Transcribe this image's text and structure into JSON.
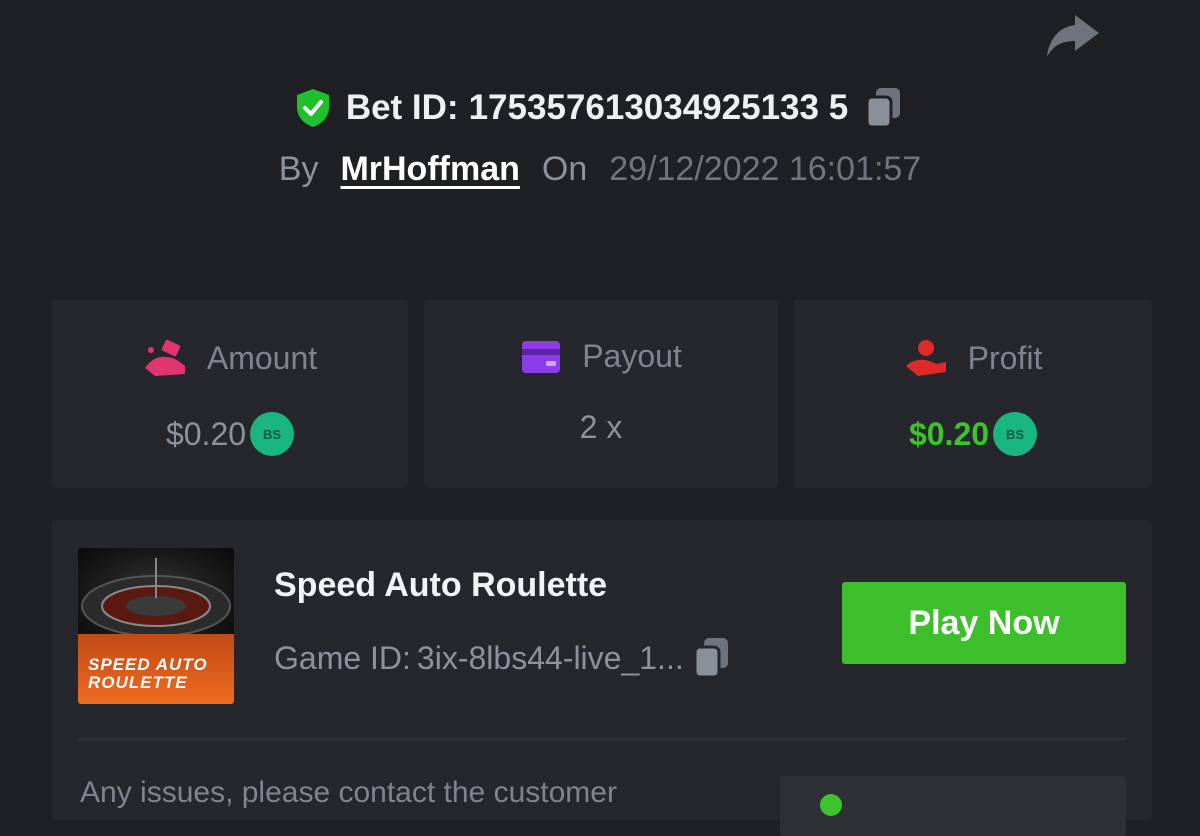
{
  "header": {
    "bet_label": "Bet ID:",
    "bet_id": "175357613034925133 5",
    "by_label": "By",
    "username": "MrHoffman",
    "on_label": "On",
    "datetime": "29/12/2022 16:01:57"
  },
  "stats": [
    {
      "label": "Amount",
      "value": "$0.20",
      "icon": "money-hand-icon",
      "color": "#e0356f"
    },
    {
      "label": "Payout",
      "value": "2 x",
      "icon": "card-icon",
      "color": "#8b3ee8"
    },
    {
      "label": "Profit",
      "value": "$0.20",
      "icon": "profit-hand-icon",
      "color": "#e02a2a"
    }
  ],
  "coin_label": "BS",
  "game": {
    "title": "Speed Auto Roulette",
    "id_label": "Game ID:",
    "id": "3ix-8lbs44-live_1...",
    "thumb_text": "SPEED AUTO ROULETTE",
    "play_label": "Play Now"
  },
  "support": {
    "text": "Any issues, please contact the customer"
  },
  "colors": {
    "accent_green": "#3cbf2a",
    "shield_green": "#1fbf2d",
    "background": "#1f2024",
    "card": "#26272c"
  }
}
